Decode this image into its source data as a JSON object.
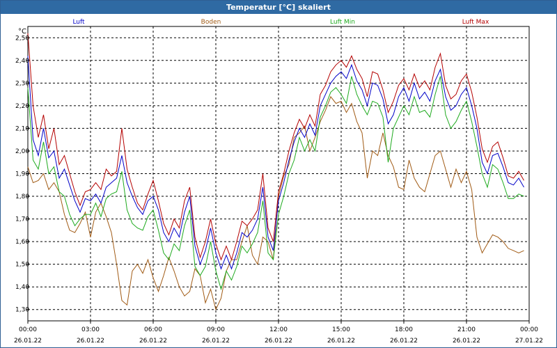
{
  "window": {
    "title": "Temperatur [°C] skaliert"
  },
  "chart_data": {
    "type": "line",
    "title": "Temperatur [°C] skaliert",
    "ylabel": "°C",
    "ylim": [
      1.25,
      2.55
    ],
    "xlim": [
      "2022-01-26 00:00",
      "2022-01-27 00:00"
    ],
    "y_ticks": [
      "2,50",
      "2,40",
      "2,30",
      "2,20",
      "2,10",
      "2,00",
      "1,90",
      "1,80",
      "1,70",
      "1,60",
      "1,50",
      "1,40",
      "1,30"
    ],
    "x_ticks": [
      {
        "time": "00:00",
        "date": "26.01.22"
      },
      {
        "time": "03:00",
        "date": "26.01.22"
      },
      {
        "time": "06:00",
        "date": "26.01.22"
      },
      {
        "time": "09:00",
        "date": "26.01.22"
      },
      {
        "time": "12:00",
        "date": "26.01.22"
      },
      {
        "time": "15:00",
        "date": "26.01.22"
      },
      {
        "time": "18:00",
        "date": "26.01.22"
      },
      {
        "time": "21:00",
        "date": "26.01.22"
      },
      {
        "time": "00:00",
        "date": "27.01.22"
      }
    ],
    "grid": true,
    "legend_position": "top",
    "x_hours": [
      0,
      0.25,
      0.5,
      0.75,
      1,
      1.25,
      1.5,
      1.75,
      2,
      2.25,
      2.5,
      2.75,
      3,
      3.25,
      3.5,
      3.75,
      4,
      4.25,
      4.5,
      4.75,
      5,
      5.25,
      5.5,
      5.75,
      6,
      6.25,
      6.5,
      6.75,
      7,
      7.25,
      7.5,
      7.75,
      8,
      8.25,
      8.5,
      8.75,
      9,
      9.25,
      9.5,
      9.75,
      10,
      10.25,
      10.5,
      10.75,
      11,
      11.25,
      11.5,
      11.75,
      12,
      12.25,
      12.5,
      12.75,
      13,
      13.25,
      13.5,
      13.75,
      14,
      14.25,
      14.5,
      14.75,
      15,
      15.25,
      15.5,
      15.75,
      16,
      16.25,
      16.5,
      16.75,
      17,
      17.25,
      17.5,
      17.75,
      18,
      18.25,
      18.5,
      18.75,
      19,
      19.25,
      19.5,
      19.75,
      20,
      20.25,
      20.5,
      20.75,
      21,
      21.25,
      21.5,
      21.75,
      22,
      22.25,
      22.5,
      22.75,
      23,
      23.25,
      23.5,
      23.75
    ],
    "series": [
      {
        "name": "Luft",
        "color": "#0000c8",
        "values": [
          2.42,
          2.05,
          1.98,
          2.1,
          1.97,
          2.0,
          1.88,
          1.92,
          1.85,
          1.78,
          1.73,
          1.79,
          1.78,
          1.81,
          1.77,
          1.84,
          1.86,
          1.88,
          1.98,
          1.86,
          1.8,
          1.75,
          1.72,
          1.78,
          1.8,
          1.74,
          1.64,
          1.6,
          1.66,
          1.62,
          1.73,
          1.8,
          1.58,
          1.5,
          1.56,
          1.66,
          1.55,
          1.48,
          1.54,
          1.48,
          1.55,
          1.64,
          1.62,
          1.65,
          1.7,
          1.84,
          1.62,
          1.56,
          1.78,
          1.86,
          1.96,
          2.04,
          2.1,
          2.06,
          2.12,
          2.07,
          2.2,
          2.25,
          2.3,
          2.33,
          2.35,
          2.32,
          2.38,
          2.31,
          2.27,
          2.2,
          2.3,
          2.29,
          2.23,
          2.12,
          2.16,
          2.24,
          2.28,
          2.22,
          2.3,
          2.23,
          2.26,
          2.22,
          2.31,
          2.36,
          2.24,
          2.18,
          2.2,
          2.25,
          2.28,
          2.2,
          2.1,
          1.95,
          1.9,
          1.98,
          1.99,
          1.93,
          1.86,
          1.85,
          1.88,
          1.84,
          1.86,
          1.92
        ]
      },
      {
        "name": "Boden",
        "color": "#a05a14",
        "values": [
          1.93,
          1.86,
          1.87,
          1.9,
          1.83,
          1.86,
          1.82,
          1.72,
          1.65,
          1.64,
          1.68,
          1.73,
          1.62,
          1.73,
          1.77,
          1.71,
          1.64,
          1.5,
          1.34,
          1.32,
          1.47,
          1.5,
          1.46,
          1.52,
          1.44,
          1.38,
          1.45,
          1.53,
          1.47,
          1.4,
          1.36,
          1.38,
          1.48,
          1.45,
          1.33,
          1.39,
          1.3,
          1.35,
          1.47,
          1.52,
          1.52,
          1.6,
          1.67,
          1.54,
          1.5,
          1.62,
          1.6,
          1.52,
          1.8,
          1.89,
          1.94,
          2.06,
          2.08,
          2.11,
          2.0,
          2.06,
          2.13,
          2.18,
          2.24,
          2.21,
          2.22,
          2.17,
          2.21,
          2.13,
          2.08,
          1.88,
          2.0,
          1.98,
          2.08,
          1.98,
          1.93,
          1.84,
          1.83,
          1.96,
          1.88,
          1.84,
          1.82,
          1.9,
          1.98,
          2.0,
          1.92,
          1.84,
          1.92,
          1.86,
          1.91,
          1.83,
          1.62,
          1.55,
          1.59,
          1.63,
          1.62,
          1.6,
          1.57,
          1.56,
          1.55,
          1.56,
          1.58,
          1.65
        ]
      },
      {
        "name": "Luft Min",
        "color": "#1eaa1e",
        "values": [
          2.28,
          1.96,
          1.92,
          2.04,
          1.9,
          1.93,
          1.82,
          1.8,
          1.72,
          1.67,
          1.7,
          1.72,
          1.72,
          1.77,
          1.71,
          1.79,
          1.81,
          1.82,
          1.91,
          1.74,
          1.68,
          1.66,
          1.65,
          1.71,
          1.74,
          1.65,
          1.55,
          1.52,
          1.59,
          1.56,
          1.67,
          1.74,
          1.49,
          1.45,
          1.49,
          1.6,
          1.47,
          1.39,
          1.47,
          1.43,
          1.49,
          1.58,
          1.55,
          1.59,
          1.64,
          1.78,
          1.55,
          1.52,
          1.72,
          1.8,
          1.9,
          1.96,
          2.06,
          2.0,
          2.05,
          2.0,
          2.15,
          2.2,
          2.26,
          2.28,
          2.25,
          2.21,
          2.33,
          2.25,
          2.2,
          2.16,
          2.22,
          2.21,
          2.15,
          1.95,
          2.1,
          2.15,
          2.2,
          2.16,
          2.24,
          2.17,
          2.18,
          2.15,
          2.25,
          2.33,
          2.16,
          2.1,
          2.13,
          2.18,
          2.22,
          2.13,
          2.02,
          1.9,
          1.84,
          1.94,
          1.92,
          1.86,
          1.79,
          1.79,
          1.81,
          1.8,
          1.81,
          1.87
        ]
      },
      {
        "name": "Luft Max",
        "color": "#b40000",
        "values": [
          2.52,
          2.2,
          2.06,
          2.16,
          2.01,
          2.1,
          1.94,
          1.98,
          1.9,
          1.82,
          1.76,
          1.82,
          1.83,
          1.86,
          1.83,
          1.92,
          1.89,
          1.91,
          2.1,
          1.92,
          1.84,
          1.77,
          1.74,
          1.81,
          1.87,
          1.78,
          1.68,
          1.63,
          1.7,
          1.66,
          1.78,
          1.84,
          1.62,
          1.53,
          1.6,
          1.7,
          1.59,
          1.52,
          1.58,
          1.52,
          1.6,
          1.69,
          1.67,
          1.7,
          1.74,
          1.9,
          1.66,
          1.6,
          1.82,
          1.9,
          2.0,
          2.08,
          2.14,
          2.1,
          2.16,
          2.11,
          2.25,
          2.29,
          2.35,
          2.38,
          2.4,
          2.37,
          2.42,
          2.36,
          2.32,
          2.24,
          2.35,
          2.34,
          2.27,
          2.17,
          2.22,
          2.29,
          2.32,
          2.27,
          2.34,
          2.28,
          2.31,
          2.27,
          2.37,
          2.43,
          2.29,
          2.23,
          2.25,
          2.31,
          2.34,
          2.26,
          2.15,
          2.01,
          1.95,
          2.02,
          2.04,
          1.97,
          1.89,
          1.88,
          1.91,
          1.87,
          1.9,
          2.05
        ]
      }
    ]
  }
}
